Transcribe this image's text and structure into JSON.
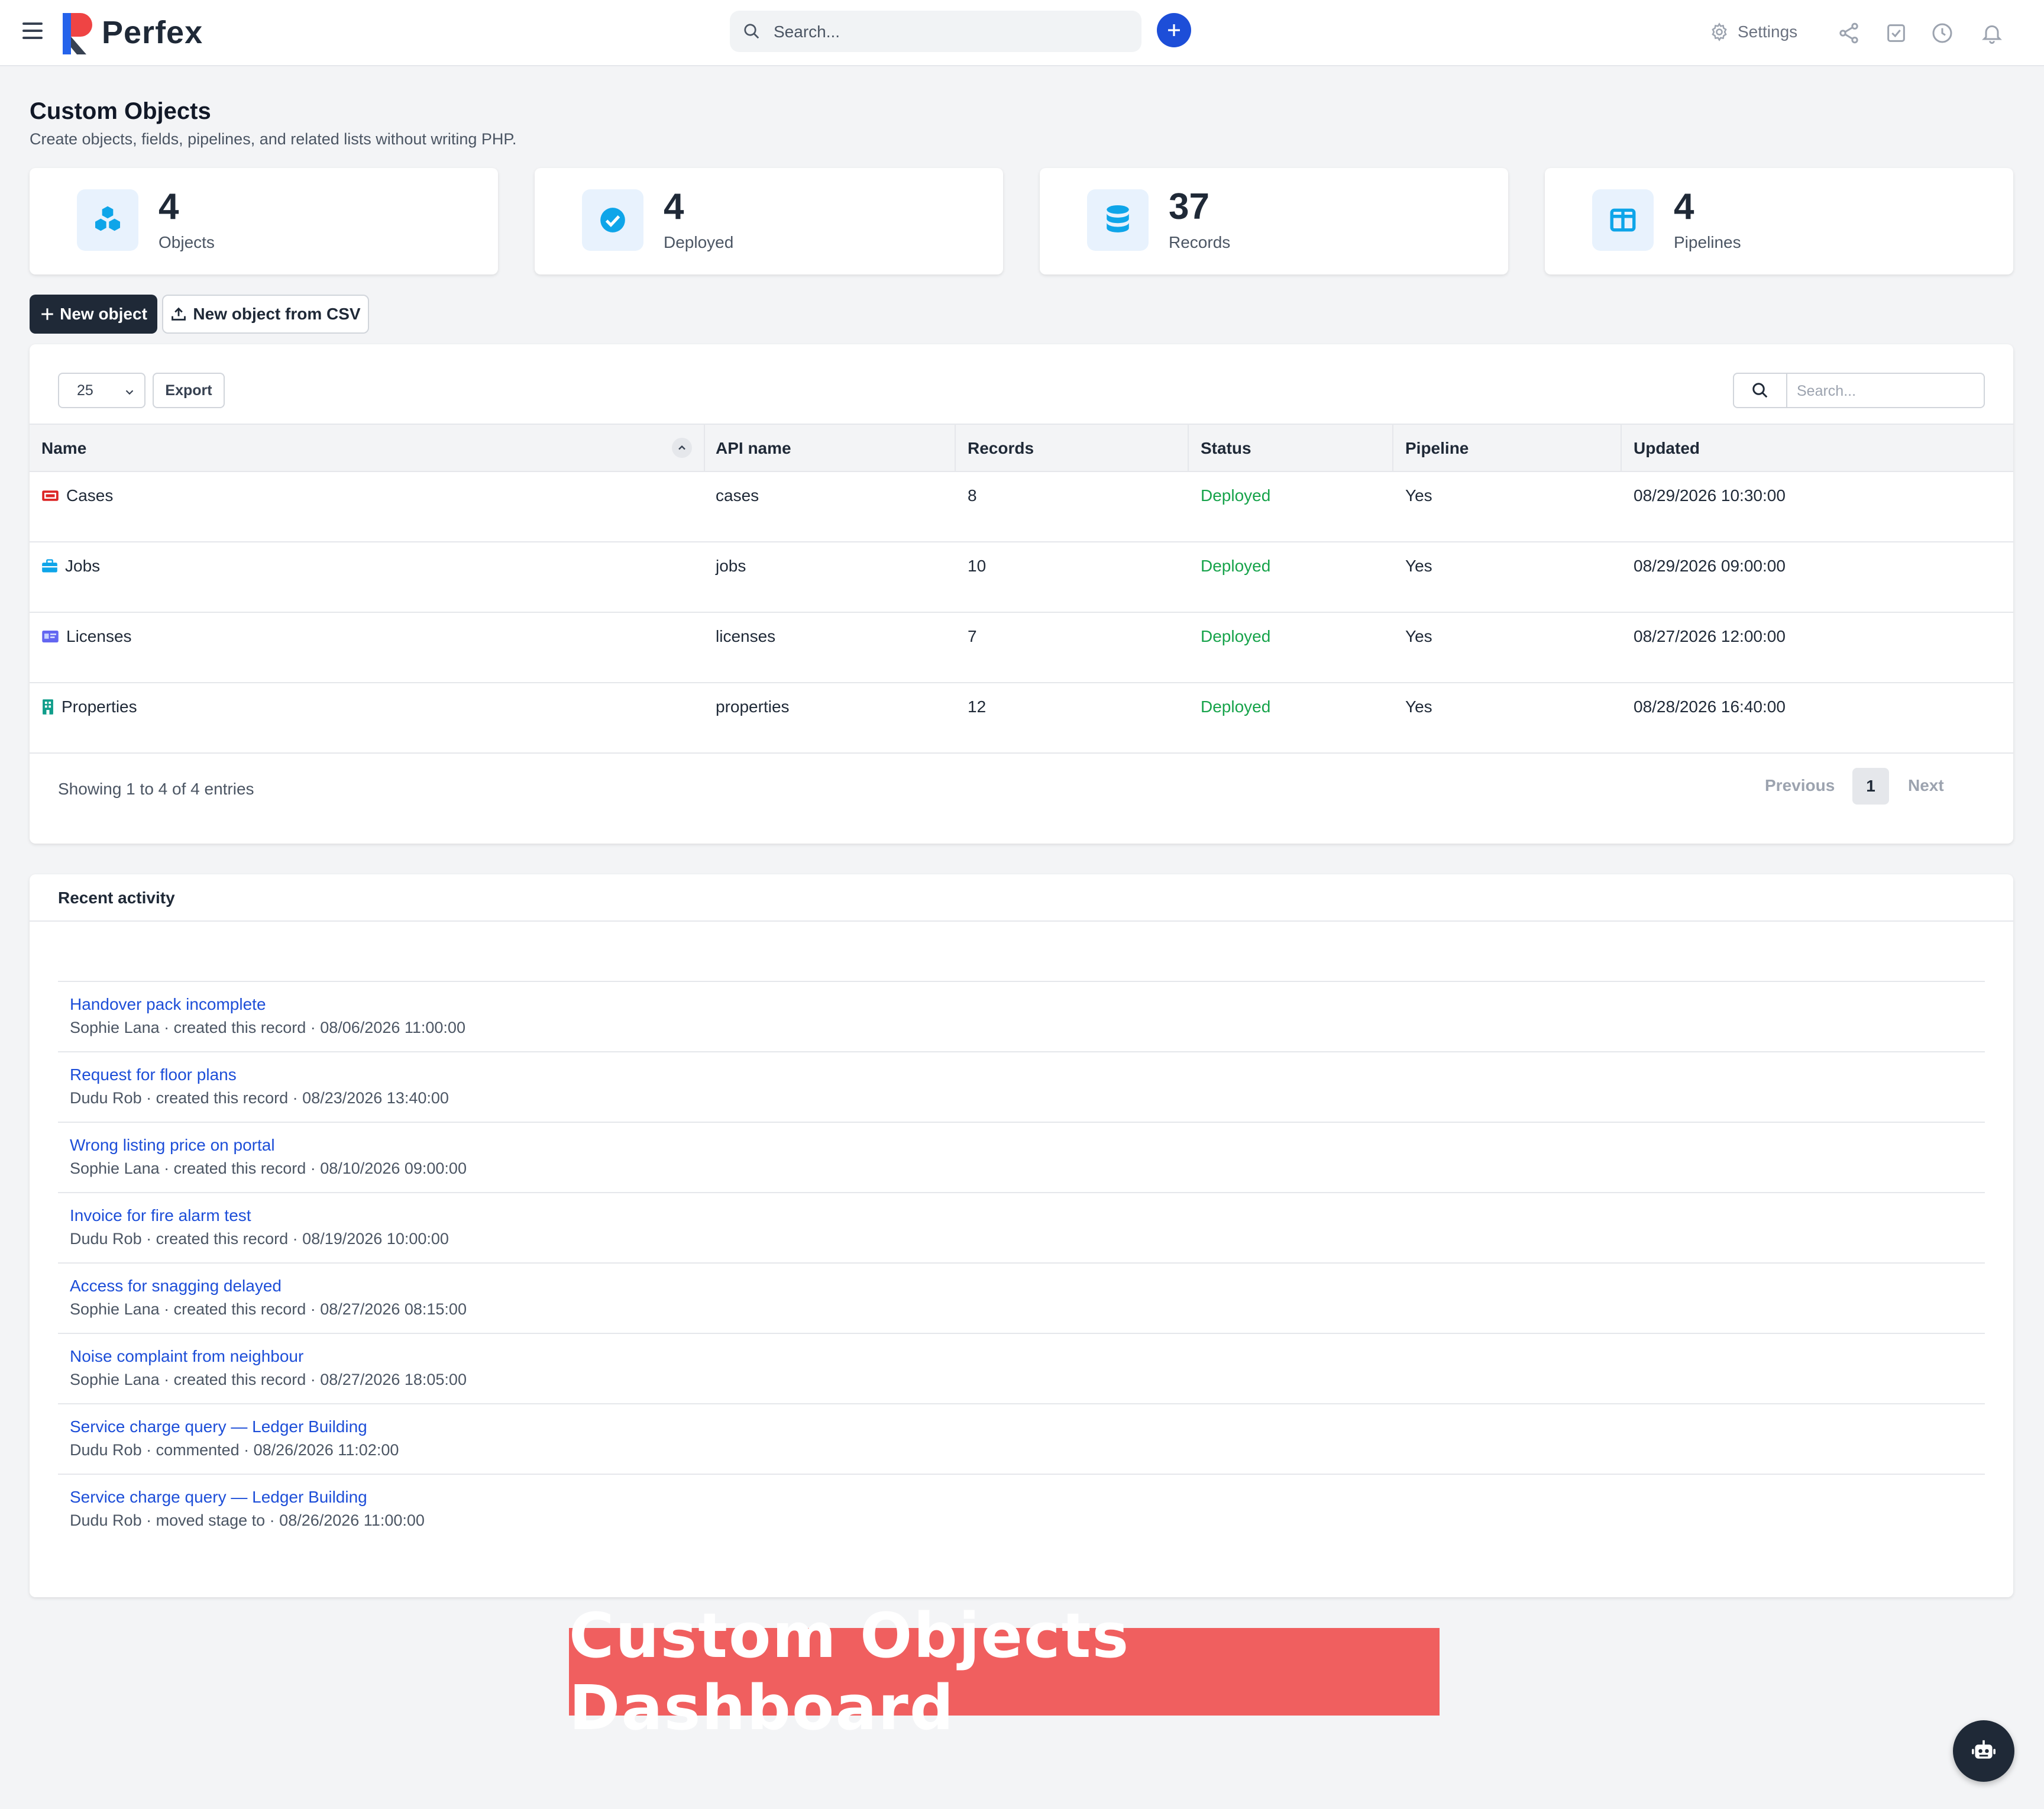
{
  "header": {
    "brand": "Perfex",
    "search_placeholder": "Search...",
    "settings_label": "Settings"
  },
  "page": {
    "title": "Custom Objects",
    "subtitle": "Create objects, fields, pipelines, and related lists without writing PHP."
  },
  "stats": [
    {
      "value": "4",
      "label": "Objects",
      "icon": "cubes-icon"
    },
    {
      "value": "4",
      "label": "Deployed",
      "icon": "check-circle-icon"
    },
    {
      "value": "37",
      "label": "Records",
      "icon": "database-icon"
    },
    {
      "value": "4",
      "label": "Pipelines",
      "icon": "columns-icon"
    }
  ],
  "actions": {
    "new_object": "New object",
    "new_from_csv": "New object from CSV"
  },
  "table": {
    "page_size": "25",
    "export_label": "Export",
    "search_placeholder": "Search...",
    "columns": [
      "Name",
      "API name",
      "Records",
      "Status",
      "Pipeline",
      "Updated"
    ],
    "rows": [
      {
        "name": "Cases",
        "api": "cases",
        "records": "8",
        "status": "Deployed",
        "pipeline": "Yes",
        "updated": "08/29/2026 10:30:00",
        "icon": "ticket-icon",
        "color": "#dc2626"
      },
      {
        "name": "Jobs",
        "api": "jobs",
        "records": "10",
        "status": "Deployed",
        "pipeline": "Yes",
        "updated": "08/29/2026 09:00:00",
        "icon": "briefcase-icon",
        "color": "#0ea5e9"
      },
      {
        "name": "Licenses",
        "api": "licenses",
        "records": "7",
        "status": "Deployed",
        "pipeline": "Yes",
        "updated": "08/27/2026 12:00:00",
        "icon": "id-card-icon",
        "color": "#6366f1"
      },
      {
        "name": "Properties",
        "api": "properties",
        "records": "12",
        "status": "Deployed",
        "pipeline": "Yes",
        "updated": "08/28/2026 16:40:00",
        "icon": "building-icon",
        "color": "#0f9d8a"
      }
    ],
    "showing": "Showing 1 to 4 of 4 entries",
    "previous": "Previous",
    "page": "1",
    "next": "Next"
  },
  "activity": {
    "title": "Recent activity",
    "items": [
      {
        "title": "Handover pack incomplete",
        "meta": "Sophie Lana · created this record · 08/06/2026 11:00:00"
      },
      {
        "title": "Request for floor plans",
        "meta": "Dudu Rob · created this record · 08/23/2026 13:40:00"
      },
      {
        "title": "Wrong listing price on portal",
        "meta": "Sophie Lana · created this record · 08/10/2026 09:00:00"
      },
      {
        "title": "Invoice for fire alarm test",
        "meta": "Dudu Rob · created this record · 08/19/2026 10:00:00"
      },
      {
        "title": "Access for snagging delayed",
        "meta": "Sophie Lana · created this record · 08/27/2026 08:15:00"
      },
      {
        "title": "Noise complaint from neighbour",
        "meta": "Sophie Lana · created this record · 08/27/2026 18:05:00"
      },
      {
        "title": "Service charge query — Ledger Building",
        "meta": "Dudu Rob · commented · 08/26/2026 11:02:00"
      },
      {
        "title": "Service charge query — Ledger Building",
        "meta": "Dudu Rob · moved stage to · 08/26/2026 11:00:00"
      }
    ]
  },
  "banner": "Custom Objects Dashboard",
  "colors": {
    "accent": "#1d4ed8",
    "success": "#16a34a",
    "dark": "#1f2937",
    "banner": "#f05f5f"
  }
}
